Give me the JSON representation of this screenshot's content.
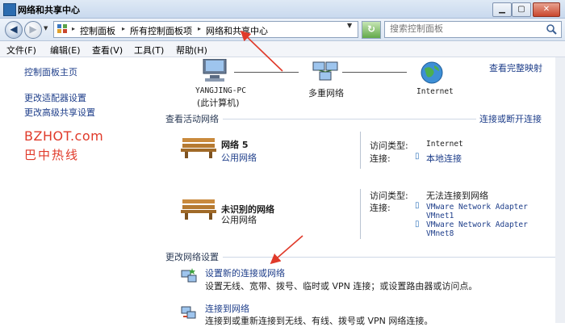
{
  "window": {
    "title": "网络和共享中心",
    "min_label": "▁",
    "max_label": "▢",
    "close_label": "✕"
  },
  "address_bar": {
    "back_glyph": "◀",
    "forward_glyph": "▶",
    "breadcrumbs": [
      "控制面板",
      "所有控制面板项",
      "网络和共享中心"
    ],
    "refresh_glyph": "↻",
    "search_placeholder": "搜索控制面板"
  },
  "menu": {
    "items": [
      "文件(F)",
      "编辑(E)",
      "查看(V)",
      "工具(T)",
      "帮助(H)"
    ]
  },
  "sidebar": {
    "items": [
      {
        "label": "控制面板主页"
      },
      {
        "label": "更改适配器设置"
      },
      {
        "label": "更改高级共享设置"
      }
    ],
    "watermark_en": "BZHOT.com",
    "watermark_cn": "巴中热线"
  },
  "network_map": {
    "view_full_map": "查看完整映射",
    "computer_label_1": "YANGJING-PC",
    "computer_label_2": "(此计算机)",
    "middle_label": "多重网络",
    "internet_label": "Internet"
  },
  "active_networks": {
    "heading": "查看活动网络",
    "connect_link": "连接或断开连接",
    "networks": [
      {
        "name": "网络  5",
        "type": "公用网络",
        "access_label": "访问类型:",
        "access_value": "Internet",
        "conn_label": "连接:",
        "connections": [
          "本地连接"
        ]
      },
      {
        "name": "未识别的网络",
        "type": "公用网络",
        "access_label": "访问类型:",
        "access_value": "无法连接到网络",
        "conn_label": "连接:",
        "connections": [
          "VMware Network Adapter",
          "VMnet1",
          "VMware Network Adapter",
          "VMnet8"
        ]
      }
    ]
  },
  "change_settings": {
    "heading": "更改网络设置",
    "tasks": [
      {
        "title": "设置新的连接或网络",
        "desc": "设置无线、宽带、拨号、临时或 VPN 连接；或设置路由器或访问点。"
      },
      {
        "title": "连接到网络",
        "desc": "连接到或重新连接到无线、有线、拨号或 VPN 网络连接。"
      }
    ]
  },
  "colors": {
    "link": "#1e3e8a",
    "annotation_arrow": "#e03a2a",
    "heading": "#2a3a55"
  }
}
